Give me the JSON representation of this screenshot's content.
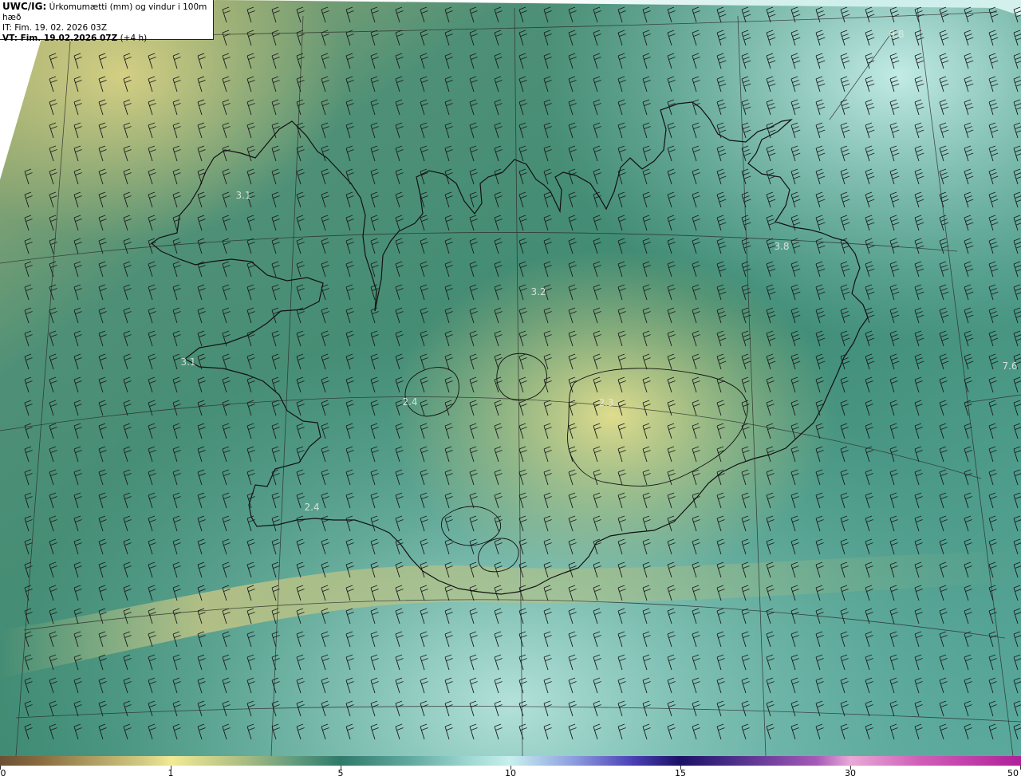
{
  "title": {
    "product": "UWC/IG:",
    "description": "Úrkomumætti (mm) og vindur i 100m hæð",
    "it_label": "IT: Fim. 19. 02. 2026 03Z",
    "vt_label": "VT: Fim. 19.02.2026 07Z",
    "vt_offset": "(+4 h)"
  },
  "map_labels": [
    {
      "text": "9.8",
      "pos": [
        1124,
        47
      ]
    },
    {
      "text": "3.1",
      "pos": [
        305,
        249
      ]
    },
    {
      "text": "3.8",
      "pos": [
        980,
        313
      ]
    },
    {
      "text": "3.2",
      "pos": [
        675,
        370
      ]
    },
    {
      "text": "3.1",
      "pos": [
        236,
        458
      ]
    },
    {
      "text": "7.6",
      "pos": [
        1266,
        463
      ]
    },
    {
      "text": "2.4",
      "pos": [
        514,
        508
      ]
    },
    {
      "text": "2.3",
      "pos": [
        760,
        509
      ]
    },
    {
      "text": "2.4",
      "pos": [
        391,
        640
      ]
    }
  ],
  "colorbar": {
    "ticks": [
      "0",
      "1",
      "5",
      "10",
      "15",
      "30",
      "50"
    ]
  },
  "colors": {
    "low": "#c9c47c",
    "mid": "#3c8a72",
    "high": "#a7e2dc",
    "coast": "#111111",
    "grid": "#2a2a2a"
  }
}
